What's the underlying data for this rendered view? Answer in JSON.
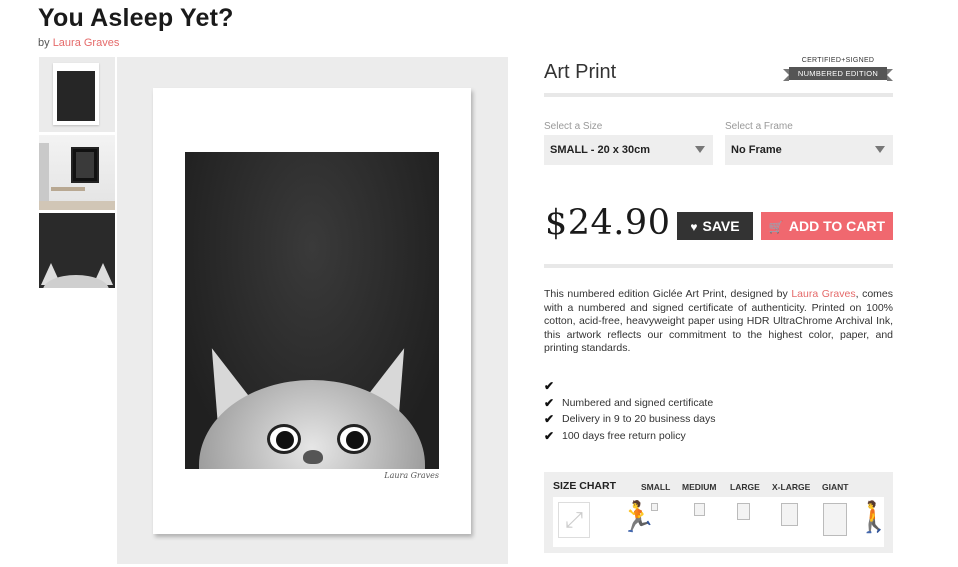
{
  "title": "You Asleep Yet?",
  "byline": {
    "prefix": "by",
    "artist": "Laura Graves"
  },
  "product": {
    "type": "Art Print"
  },
  "badge": {
    "top": "CERTIFIED+SIGNED",
    "ribbon": "NUMBERED EDITION"
  },
  "options": {
    "size": {
      "label": "Select a Size",
      "value": "SMALL - 20 x 30cm"
    },
    "frame": {
      "label": "Select a Frame",
      "value": "No Frame"
    }
  },
  "price": "$24.90",
  "buttons": {
    "save": "SAVE",
    "cart": "ADD TO CART"
  },
  "description": {
    "part1": "This numbered edition Giclée Art Print, designed by ",
    "artist": "Laura Graves",
    "part2": ", comes with a numbered and signed certificate of authenticity. Printed on 100% cotton, acid-free, heavyweight paper using HDR UltraChrome Archival Ink, this artwork reflects our commitment to the highest color, paper, and printing standards."
  },
  "features": [
    "",
    "Numbered and signed certificate",
    "Delivery in 9 to 20 business days",
    "100 days free return policy"
  ],
  "size_chart": {
    "label": "SIZE CHART",
    "columns": [
      "SMALL",
      "MEDIUM",
      "LARGE",
      "X-LARGE",
      "GIANT"
    ]
  },
  "artwork": {
    "signature": "Laura Graves"
  },
  "colors": {
    "accent": "#f0686f",
    "link": "#e56a6a",
    "dark_button": "#333333"
  }
}
